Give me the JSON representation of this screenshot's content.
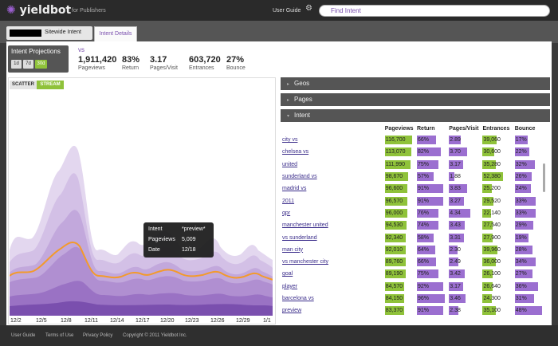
{
  "header": {
    "brand": "yieldbot",
    "tagline": "for Publishers",
    "user_guide": "User Guide",
    "search_placeholder": "Find Intent"
  },
  "nav": {
    "crumb": "Sitewide Intent",
    "tab": "Intent Details"
  },
  "projections": {
    "title": "Intent Projections",
    "ranges": [
      "1d",
      "7d",
      "30d"
    ],
    "active": "30d"
  },
  "summary": {
    "term": "vs",
    "stats": [
      {
        "value": "1,911,420",
        "label": "Pageviews"
      },
      {
        "value": "83%",
        "label": "Return"
      },
      {
        "value": "3.17",
        "label": "Pages/Visit"
      },
      {
        "value": "603,720",
        "label": "Entrances"
      },
      {
        "value": "27%",
        "label": "Bounce"
      }
    ]
  },
  "view_toggle": {
    "scatter": "SCATTER",
    "stream": "STREAM",
    "active": "stream"
  },
  "chart_data": {
    "type": "area",
    "x_ticks": [
      "12/2",
      "12/5",
      "12/8",
      "12/11",
      "12/14",
      "12/17",
      "12/20",
      "12/23",
      "12/26",
      "12/29",
      "1/1"
    ]
  },
  "tooltip": {
    "rows": [
      {
        "k": "Intent",
        "v": "*preview*"
      },
      {
        "k": "Pageviews",
        "v": "5,009"
      },
      {
        "k": "Date",
        "v": "12/18"
      }
    ]
  },
  "panels": [
    "Geos",
    "Pages",
    "Intent"
  ],
  "table": {
    "headers": [
      "",
      "Pageviews",
      "Return",
      "Pages/Visit",
      "Entrances",
      "Bounce"
    ],
    "rows": [
      {
        "name": "city vs",
        "pv": "116,700",
        "pvf": 0.95,
        "ret": "66%",
        "retf": 0.66,
        "ppv": "2.89",
        "ppvf": 0.4,
        "ent": "39,060",
        "entf": 0.5,
        "bn": "17%",
        "bnf": 0.45
      },
      {
        "name": "chelsea vs",
        "pv": "113,070",
        "pvf": 0.92,
        "ret": "82%",
        "retf": 0.82,
        "ppv": "3.70",
        "ppvf": 0.62,
        "ent": "30,600",
        "entf": 0.4,
        "bn": "22%",
        "bnf": 0.52
      },
      {
        "name": "united",
        "pv": "111,990",
        "pvf": 0.9,
        "ret": "75%",
        "retf": 0.75,
        "ppv": "3.17",
        "ppvf": 0.5,
        "ent": "35,280",
        "entf": 0.46,
        "bn": "32%",
        "bnf": 0.7
      },
      {
        "name": "sunderland vs",
        "pv": "98,670",
        "pvf": 0.8,
        "ret": "57%",
        "retf": 0.57,
        "ppv": "1.88",
        "ppvf": 0.2,
        "ent": "52,380",
        "entf": 0.7,
        "bn": "26%",
        "bnf": 0.6
      },
      {
        "name": "madrid vs",
        "pv": "96,600",
        "pvf": 0.78,
        "ret": "91%",
        "retf": 0.91,
        "ppv": "3.83",
        "ppvf": 0.64,
        "ent": "25,200",
        "entf": 0.33,
        "bn": "24%",
        "bnf": 0.56
      },
      {
        "name": "2011",
        "pv": "96,570",
        "pvf": 0.78,
        "ret": "91%",
        "retf": 0.91,
        "ppv": "3.27",
        "ppvf": 0.52,
        "ent": "29,520",
        "entf": 0.38,
        "bn": "33%",
        "bnf": 0.72
      },
      {
        "name": "qpr",
        "pv": "96,000",
        "pvf": 0.78,
        "ret": "76%",
        "retf": 0.76,
        "ppv": "4.34",
        "ppvf": 0.75,
        "ent": "22,140",
        "entf": 0.29,
        "bn": "33%",
        "bnf": 0.72
      },
      {
        "name": "manchester united",
        "pv": "94,530",
        "pvf": 0.76,
        "ret": "74%",
        "retf": 0.74,
        "ppv": "3.43",
        "ppvf": 0.56,
        "ent": "27,540",
        "entf": 0.36,
        "bn": "29%",
        "bnf": 0.64
      },
      {
        "name": "vs sunderland",
        "pv": "92,340",
        "pvf": 0.74,
        "ret": "58%",
        "retf": 0.58,
        "ppv": "3.31",
        "ppvf": 0.53,
        "ent": "27,900",
        "entf": 0.36,
        "bn": "19%",
        "bnf": 0.48
      },
      {
        "name": "man city",
        "pv": "92,010",
        "pvf": 0.74,
        "ret": "64%",
        "retf": 0.64,
        "ppv": "2.30",
        "ppvf": 0.3,
        "ent": "39,960",
        "entf": 0.52,
        "bn": "28%",
        "bnf": 0.62
      },
      {
        "name": "vs manchester city",
        "pv": "89,760",
        "pvf": 0.72,
        "ret": "66%",
        "retf": 0.66,
        "ppv": "2.49",
        "ppvf": 0.34,
        "ent": "36,000",
        "entf": 0.47,
        "bn": "34%",
        "bnf": 0.74
      },
      {
        "name": "goal",
        "pv": "89,190",
        "pvf": 0.72,
        "ret": "75%",
        "retf": 0.75,
        "ppv": "3.42",
        "ppvf": 0.56,
        "ent": "26,100",
        "entf": 0.34,
        "bn": "27%",
        "bnf": 0.61
      },
      {
        "name": "player",
        "pv": "84,570",
        "pvf": 0.68,
        "ret": "92%",
        "retf": 0.92,
        "ppv": "3.17",
        "ppvf": 0.5,
        "ent": "26,640",
        "entf": 0.35,
        "bn": "36%",
        "bnf": 0.8
      },
      {
        "name": "barcelona vs",
        "pv": "84,150",
        "pvf": 0.68,
        "ret": "96%",
        "retf": 0.96,
        "ppv": "3.46",
        "ppvf": 0.57,
        "ent": "24,300",
        "entf": 0.32,
        "bn": "31%",
        "bnf": 0.68
      },
      {
        "name": "preview",
        "pv": "83,370",
        "pvf": 0.67,
        "ret": "91%",
        "retf": 0.91,
        "ppv": "2.38",
        "ppvf": 0.32,
        "ent": "35,100",
        "entf": 0.46,
        "bn": "48%",
        "bnf": 0.95
      }
    ]
  },
  "footer": [
    "User Guide",
    "Terms of Use",
    "Privacy Policy",
    "Copyright © 2011 Yieldbot Inc."
  ]
}
